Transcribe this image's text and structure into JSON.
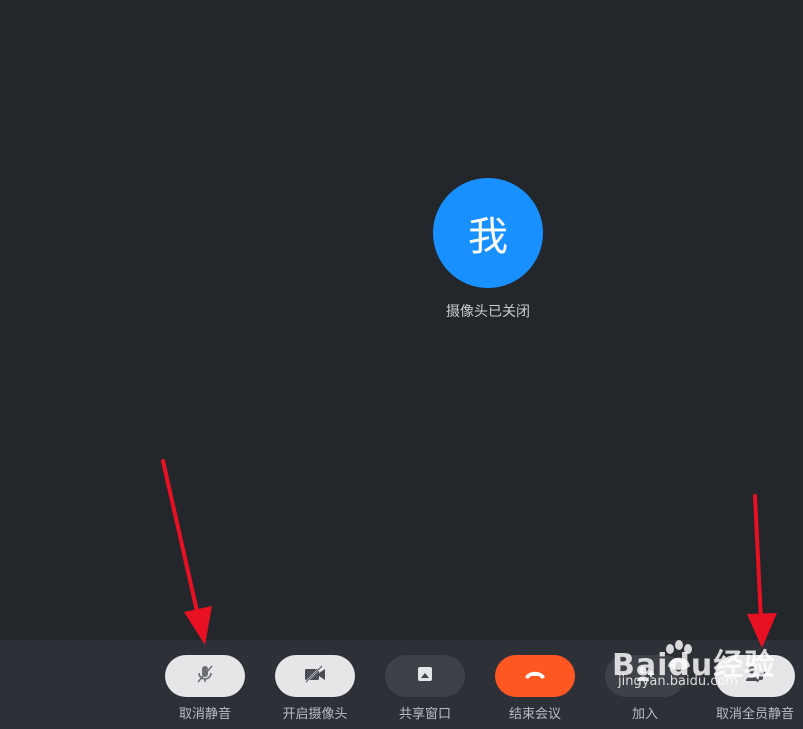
{
  "avatar": {
    "text": "我",
    "color": "#1890ff"
  },
  "status": {
    "camera_off": "摄像头已关闭"
  },
  "toolbar": {
    "controls": [
      {
        "label": "取消静音",
        "icon": "mic-muted-icon",
        "style": "light"
      },
      {
        "label": "开启摄像头",
        "icon": "camera-off-icon",
        "style": "light"
      },
      {
        "label": "共享窗口",
        "icon": "share-window-icon",
        "style": "dark"
      },
      {
        "label": "结束会议",
        "icon": "hang-up-icon",
        "style": "danger"
      },
      {
        "label": "加入",
        "icon": "add-user-icon",
        "style": "dark"
      },
      {
        "label": "取消全员静音",
        "icon": "mute-all-icon",
        "style": "light"
      }
    ]
  },
  "annotations": {
    "arrow_color": "#e81123",
    "arrow_targets": [
      "取消静音",
      "取消全员静音"
    ]
  },
  "watermark": {
    "main": "Baidu经验",
    "sub": "jingyan.baidu.com"
  }
}
